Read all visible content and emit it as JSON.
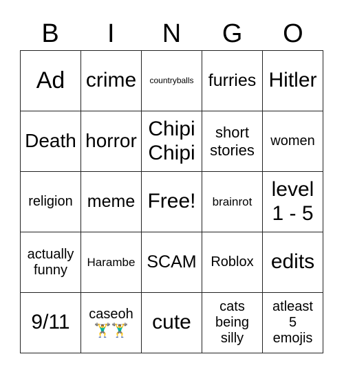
{
  "title_letters": [
    "B",
    "I",
    "N",
    "G",
    "O"
  ],
  "board": {
    "rows": [
      [
        {
          "text": "Ad",
          "size": "s-xl"
        },
        {
          "text": "crime",
          "size": "s-l"
        },
        {
          "text": "countryballs",
          "size": "s-tiny"
        },
        {
          "text": "furries",
          "size": "s-m"
        },
        {
          "text": "Hitler",
          "size": "s-l"
        }
      ],
      [
        {
          "text": "Death",
          "size": "s-ml"
        },
        {
          "text": "horror",
          "size": "s-ml"
        },
        {
          "text": "Chipi\nChipi",
          "size": "s-l"
        },
        {
          "text": "short\nstories",
          "size": "s-s"
        },
        {
          "text": "women",
          "size": "s-xs"
        }
      ],
      [
        {
          "text": "religion",
          "size": "s-xs"
        },
        {
          "text": "meme",
          "size": "s-m"
        },
        {
          "text": "Free!",
          "size": "s-l"
        },
        {
          "text": "brainrot",
          "size": "s-xxs"
        },
        {
          "text": "level\n1 - 5",
          "size": "s-l"
        }
      ],
      [
        {
          "text": "actually\nfunny",
          "size": "s-xs"
        },
        {
          "text": "Harambe",
          "size": "s-xxs"
        },
        {
          "text": "SCAM",
          "size": "s-m"
        },
        {
          "text": "Roblox",
          "size": "s-xs"
        },
        {
          "text": "edits",
          "size": "s-l"
        }
      ],
      [
        {
          "text": "9/11",
          "size": "s-l"
        },
        {
          "text": "caseoh",
          "size": "s-xs",
          "emoji": "🏋‍♂🏋‍♂"
        },
        {
          "text": "cute",
          "size": "s-l"
        },
        {
          "text": "cats\nbeing\nsilly",
          "size": "s-xs"
        },
        {
          "text": "atleast\n5\nemojis",
          "size": "s-xs"
        }
      ]
    ]
  }
}
